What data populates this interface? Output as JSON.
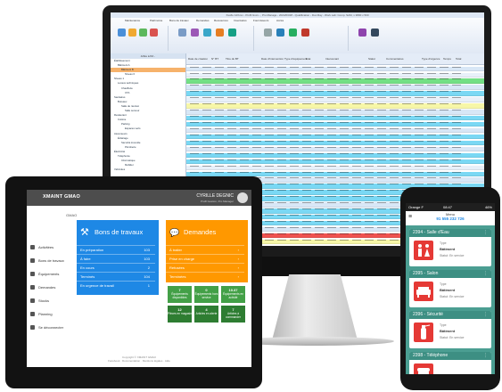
{
  "desktop": {
    "title": "Xsoftu 12Xxxx - Profil Gxxx..., Pro Manage - 2024/03/28 - Qualification - Doc.Ray - Work Lab: Comp. SAM, x 3800 x 500",
    "ribbon_tabs": [
      "Maintenance",
      "Patrimoine",
      "Bons de travaux",
      "Demandes",
      "Ressources",
      "Inventaires",
      "Fournisseurs",
      "Accès"
    ],
    "tree_header": "Arbre à IM...",
    "tree_items": [
      "Établissement",
      "Bâtiment A",
      "Bâtiment B",
      "Niveau 0",
      "Niveau 1",
      "Locaux techniques",
      "Chaufferie",
      "CTA",
      "Sanitaires",
      "Bureaux",
      "Salle de réunion",
      "Salle serveur",
      "Restaurant",
      "Cuisine",
      "Parking",
      "Espaces verts",
      "Ascenseurs",
      "Éclairage",
      "Sécurité incendie",
      "Plomberie",
      "Électricité",
      "Téléphonie",
      "Informatique",
      "Mobilier",
      "Véhicules"
    ],
    "grid_headers": [
      "Date de création",
      "N° BT",
      "Titre du BT",
      "Date d'intervention",
      "Type d'équipement",
      "Etat",
      "Intervenant",
      "Statut",
      "Commentaires",
      "Type d'urgence",
      "Temps",
      "Total"
    ],
    "row_colors": [
      "#d8e7f6",
      "#e8f0f9",
      "#73e085",
      "#d8e7f6",
      "#7ad8f4",
      "#e8f0f9",
      "#f7f7a8",
      "#d8e7f6",
      "#7ad8f4",
      "#7ad8f4",
      "#d8e7f6",
      "#7ad8f4",
      "#7ad8f4",
      "#d8e7f6",
      "#7ad8f4",
      "#7ad8f4",
      "#e8f0f9",
      "#7ad8f4",
      "#d8e7f6",
      "#7ad8f4",
      "#7ad8f4",
      "#7ad8f4",
      "#d8e7f6",
      "#7ad8f4",
      "#7ad8f4",
      "#7ad8f4",
      "#d8e7f6",
      "#ef5350",
      "#f7f7a8",
      "#d8e7f6",
      "#7ad8f4",
      "#7ad8f4",
      "#d8e7f6",
      "#7ad8f4",
      "#73e085",
      "#7ad8f4",
      "#73e085",
      "#d8e7f6",
      "#7ad8f4",
      "#73e085",
      "#d8e7f6",
      "#7ad8f4",
      "#f7f7a8",
      "#73e085",
      "#d8e7f6",
      "#7ad8f4"
    ]
  },
  "tablet": {
    "brand": "XMAINT GMAO",
    "user_name": "CYRILLE DEGNIC",
    "user_role": "Profil Gestion, Pro Manager",
    "module": "GMAO",
    "sidebar": [
      "Activitées",
      "Bons de travaux",
      "Équipements",
      "Demandes",
      "Stocks",
      "Planning",
      "Se déconnecter"
    ],
    "bons": {
      "title": "Bons de travaux",
      "rows": [
        {
          "label": "En préparation",
          "value": "103"
        },
        {
          "label": "À faire",
          "value": "103"
        },
        {
          "label": "En cours",
          "value": "2"
        },
        {
          "label": "Terminés",
          "value": "104"
        },
        {
          "label": "En urgence de travail",
          "value": "1"
        }
      ]
    },
    "demandes": {
      "title": "Demandes",
      "rows": [
        {
          "label": "À traiter",
          "value": ""
        },
        {
          "label": "Prise en charge",
          "value": ""
        },
        {
          "label": "Refusées",
          "value": ""
        },
        {
          "label": "Terminées",
          "value": ""
        }
      ]
    },
    "tiles": [
      {
        "num": "7",
        "label": "Équipements disponibles"
      },
      {
        "num": "0",
        "label": "Équipements hors service"
      },
      {
        "num": "10.37",
        "label": "Équipements en activité"
      },
      {
        "num": "12",
        "label": "Pièces en magasin"
      },
      {
        "num": "4",
        "label": "Articles en alerte"
      },
      {
        "num": "7",
        "label": "Articles à commander"
      }
    ],
    "footer_line1": "Copyright © XMAINT GMAO",
    "footer_line2": "Facebook · Documentation · Mentions légales · Aide"
  },
  "phone": {
    "carrier": "Orange F",
    "time": "08:47",
    "battery": "46%",
    "header_line1": "Menu",
    "header_line2": "91 555 232 726",
    "cards": [
      {
        "title": "2394 - Salle d'Eau",
        "type_label": "Type",
        "type_value": "Bâtiment",
        "status": "Statut: En service",
        "icon": "restroom-icon",
        "color": "#e53935"
      },
      {
        "title": "2395 - Salon",
        "type_label": "Type",
        "type_value": "Bâtiment",
        "status": "Statut: En service",
        "icon": "sofa-icon",
        "color": "#e53935"
      },
      {
        "title": "2396 - Sécurité",
        "type_label": "Type",
        "type_value": "Bâtiment",
        "status": "Statut: En service",
        "icon": "fire-extinguisher-icon",
        "color": "#e53935"
      },
      {
        "title": "2398 - Téléphone",
        "type_label": "",
        "type_value": "",
        "status": "",
        "icon": "phone-icon",
        "color": "#e53935"
      }
    ]
  }
}
